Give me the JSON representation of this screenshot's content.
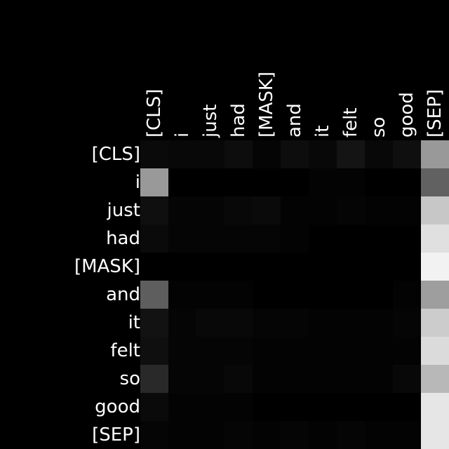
{
  "chart_data": {
    "type": "heatmap",
    "title": "",
    "xlabel": "",
    "ylabel": "",
    "x_tokens": [
      "[CLS]",
      "i",
      "just",
      "had",
      "[MASK]",
      "and",
      "it",
      "felt",
      "so",
      "good",
      "[SEP]"
    ],
    "y_tokens": [
      "[CLS]",
      "i",
      "just",
      "had",
      "[MASK]",
      "and",
      "it",
      "felt",
      "so",
      "good",
      "[SEP]"
    ],
    "color_scale": {
      "min": 0.0,
      "max": 1.0,
      "low_color": "#000000",
      "high_color": "#ffffff"
    },
    "matrix": [
      [
        0.04,
        0.03,
        0.03,
        0.05,
        0.02,
        0.05,
        0.03,
        0.08,
        0.03,
        0.06,
        0.6
      ],
      [
        0.6,
        0.0,
        0.0,
        0.0,
        0.0,
        0.0,
        0.01,
        0.01,
        0.0,
        0.0,
        0.38
      ],
      [
        0.06,
        0.02,
        0.02,
        0.03,
        0.04,
        0.01,
        0.01,
        0.02,
        0.01,
        0.01,
        0.78
      ],
      [
        0.04,
        0.02,
        0.02,
        0.02,
        0.02,
        0.01,
        0.0,
        0.0,
        0.0,
        0.0,
        0.88
      ],
      [
        0.0,
        0.0,
        0.0,
        0.0,
        0.0,
        0.0,
        0.0,
        0.0,
        0.0,
        0.0,
        0.95
      ],
      [
        0.37,
        0.01,
        0.01,
        0.01,
        0.0,
        0.0,
        0.0,
        0.0,
        0.0,
        0.01,
        0.62
      ],
      [
        0.07,
        0.02,
        0.03,
        0.03,
        0.02,
        0.02,
        0.01,
        0.01,
        0.01,
        0.02,
        0.8
      ],
      [
        0.06,
        0.02,
        0.02,
        0.02,
        0.01,
        0.01,
        0.01,
        0.01,
        0.01,
        0.01,
        0.86
      ],
      [
        0.16,
        0.02,
        0.02,
        0.03,
        0.01,
        0.01,
        0.01,
        0.01,
        0.01,
        0.03,
        0.72
      ],
      [
        0.04,
        0.01,
        0.01,
        0.01,
        0.0,
        0.0,
        0.0,
        0.0,
        0.0,
        0.0,
        0.9
      ],
      [
        0.02,
        0.01,
        0.01,
        0.02,
        0.01,
        0.02,
        0.01,
        0.02,
        0.01,
        0.01,
        0.9
      ]
    ]
  }
}
